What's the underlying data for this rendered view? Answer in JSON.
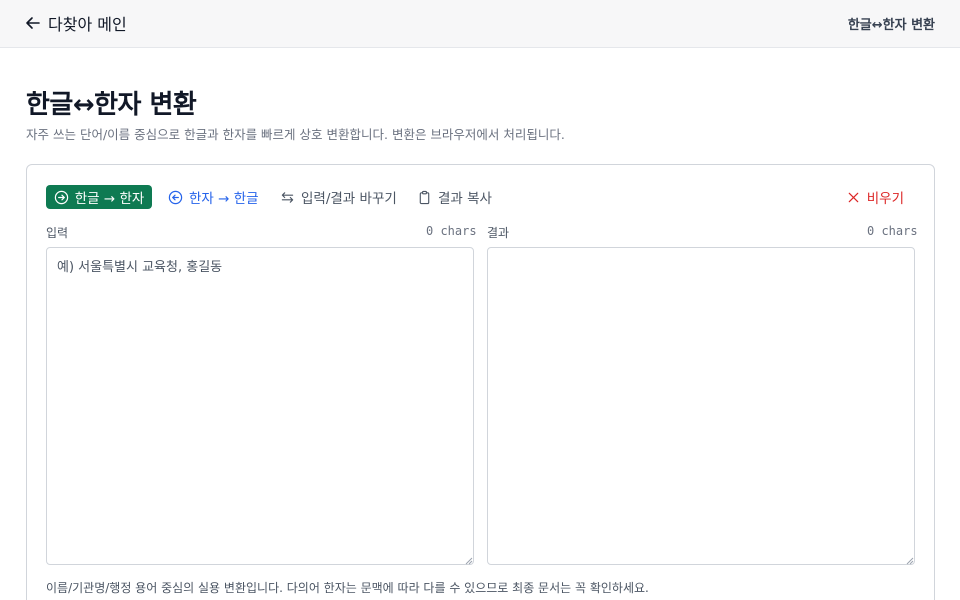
{
  "header": {
    "back_label": "다찾아 메인",
    "title": "한글↔한자 변환"
  },
  "page": {
    "title": "한글↔한자 변환",
    "subtitle": "자주 쓰는 단어/이름 중심으로 한글과 한자를 빠르게 상호 변환합니다. 변환은 브라우저에서 처리됩니다."
  },
  "toolbar": {
    "hangul_to_hanja": "한글 → 한자",
    "hanja_to_hangul": "한자 → 한글",
    "swap": "입력/결과 바꾸기",
    "copy": "결과 복사",
    "clear": "비우기"
  },
  "input": {
    "label": "입력",
    "count": "0 chars",
    "value": "",
    "placeholder": "예) 서울특별시 교육청, 홍길동"
  },
  "output": {
    "label": "결과",
    "count": "0 chars",
    "value": "",
    "placeholder": ""
  },
  "footnote": "이름/기관명/행정 용어 중심의 실용 변환입니다. 다의어 한자는 문맥에 따라 다를 수 있으므로 최종 문서는 꼭 확인하세요.",
  "colors": {
    "primary_green": "#0e7a52",
    "link_blue": "#2563eb",
    "danger_red": "#dc2626"
  },
  "icons": {
    "back": "arrow-left-icon",
    "convert": "circle-arrow-right-icon",
    "reverse": "circle-arrow-left-icon",
    "swap": "swap-arrows-icon",
    "copy": "clipboard-icon",
    "clear": "close-icon"
  }
}
